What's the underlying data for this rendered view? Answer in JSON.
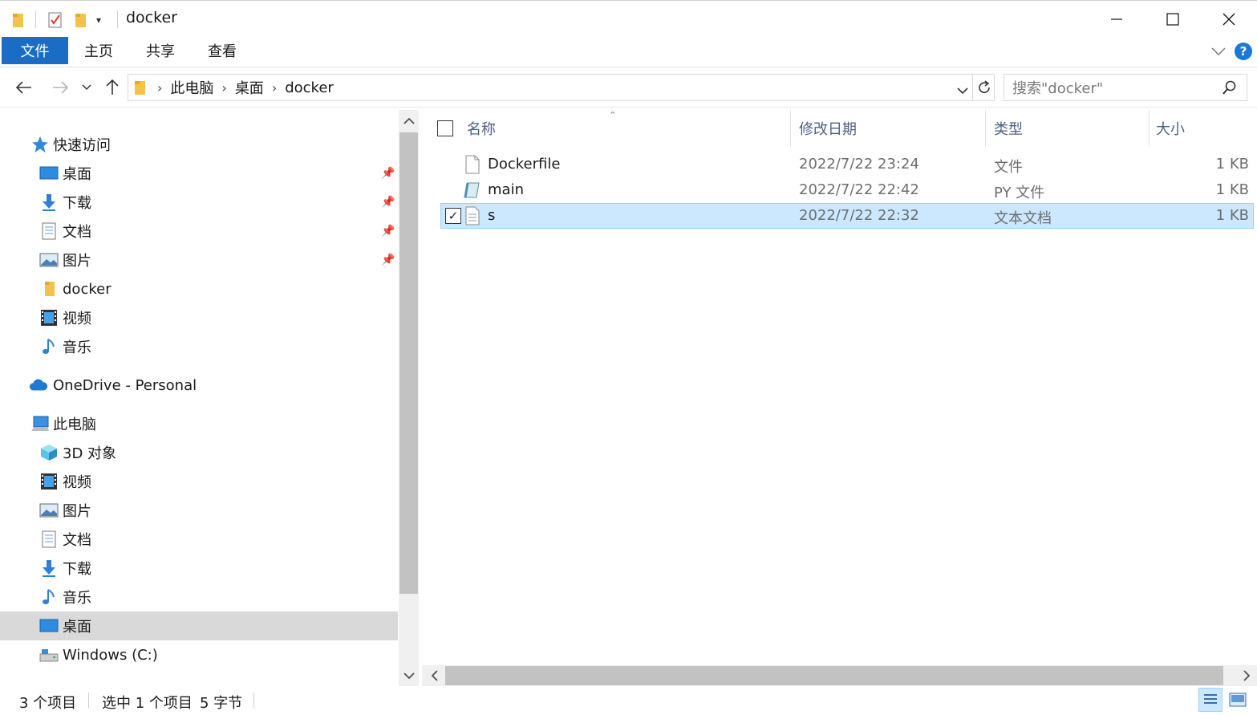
{
  "window": {
    "title": "docker",
    "accent": "#1a6cc4"
  },
  "ribbon": {
    "tabs": [
      "文件",
      "主页",
      "共享",
      "查看"
    ],
    "help_label": "?"
  },
  "address": {
    "crumbs": [
      "此电脑",
      "桌面",
      "docker"
    ],
    "search_placeholder": "搜索\"docker\""
  },
  "nav": {
    "quick_access": "快速访问",
    "quick_items": [
      {
        "label": "桌面",
        "icon": "desktop-icon",
        "pinned": true
      },
      {
        "label": "下载",
        "icon": "download-icon",
        "pinned": true
      },
      {
        "label": "文档",
        "icon": "document-icon",
        "pinned": true
      },
      {
        "label": "图片",
        "icon": "pictures-icon",
        "pinned": true
      },
      {
        "label": "docker",
        "icon": "folder-icon",
        "pinned": false
      },
      {
        "label": "视频",
        "icon": "video-icon",
        "pinned": false
      },
      {
        "label": "音乐",
        "icon": "music-icon",
        "pinned": false
      }
    ],
    "onedrive": "OneDrive - Personal",
    "this_pc": "此电脑",
    "pc_items": [
      {
        "label": "3D 对象",
        "icon": "3d-objects-icon"
      },
      {
        "label": "视频",
        "icon": "video-icon"
      },
      {
        "label": "图片",
        "icon": "pictures-icon"
      },
      {
        "label": "文档",
        "icon": "document-icon"
      },
      {
        "label": "下载",
        "icon": "download-icon"
      },
      {
        "label": "音乐",
        "icon": "music-icon"
      },
      {
        "label": "桌面",
        "icon": "desktop-icon",
        "selected": true
      },
      {
        "label": "Windows (C:)",
        "icon": "drive-icon"
      }
    ]
  },
  "list": {
    "columns": {
      "name": "名称",
      "date": "修改日期",
      "type": "类型",
      "size": "大小"
    },
    "files": [
      {
        "name": "Dockerfile",
        "date": "2022/7/22 23:24",
        "type": "文件",
        "size": "1 KB",
        "icon": "blank-file-icon",
        "selected": false
      },
      {
        "name": "main",
        "date": "2022/7/22 22:42",
        "type": "PY 文件",
        "size": "1 KB",
        "icon": "python-file-icon",
        "selected": false
      },
      {
        "name": "s",
        "date": "2022/7/22 22:32",
        "type": "文本文档",
        "size": "1 KB",
        "icon": "text-file-icon",
        "selected": true
      }
    ]
  },
  "status": {
    "item_count": "3 个项目",
    "selection": "选中 1 个项目",
    "size": "5 字节"
  }
}
